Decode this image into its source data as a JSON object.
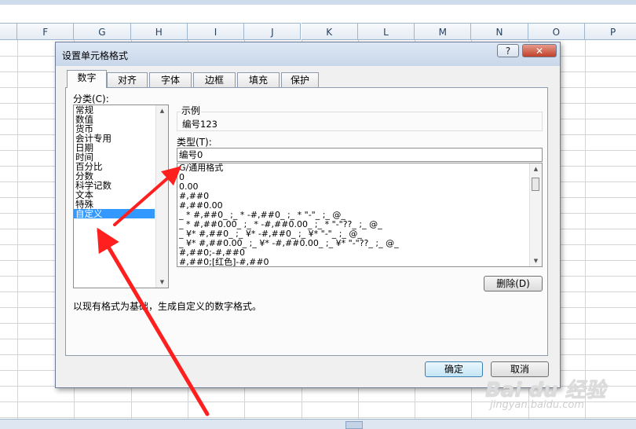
{
  "sheet": {
    "columns": [
      "F",
      "G",
      "H",
      "I",
      "J",
      "K",
      "L",
      "M",
      "N",
      "O",
      "P"
    ]
  },
  "dialog": {
    "title": "设置单元格格式",
    "help_label": "?",
    "close_label": "✕",
    "tabs": [
      "数字",
      "对齐",
      "字体",
      "边框",
      "填充",
      "保护"
    ],
    "category_label": "分类(C):",
    "categories": [
      "常规",
      "数值",
      "货币",
      "会计专用",
      "日期",
      "时间",
      "百分比",
      "分数",
      "科学记数",
      "文本",
      "特殊",
      "自定义"
    ],
    "selected_category": "自定义",
    "sample_label": "示例",
    "sample_value": "编号123",
    "type_label": "类型(T):",
    "type_value": "编号0",
    "formats": [
      "G/通用格式",
      "0",
      "0.00",
      "#,##0",
      "#,##0.00",
      "_ * #,##0_ ;_ * -#,##0_ ;_ * \"-\"_ ;_ @_",
      "_ * #,##0.00_ ;_ * -#,##0.00_ ;_ * \"-\"??_ ;_ @_",
      "_ ¥* #,##0_ ;_ ¥* -#,##0_ ;_ ¥* \"-\"_ ;_ @_",
      "_ ¥* #,##0.00_ ;_ ¥* -#,##0.00_ ;_ ¥* \"-\"??_ ;_ @_",
      "#,##0;-#,##0",
      "#,##0;[红色]-#,##0"
    ],
    "delete_label": "删除(D)",
    "description": "以现有格式为基础，生成自定义的数字格式。",
    "ok_label": "确定",
    "cancel_label": "取消"
  },
  "watermark": {
    "brand": "Bai du 经验",
    "url": "jingyan.baidu.com"
  },
  "colors": {
    "arrow": "#ff1f1f",
    "selection": "#3399ff",
    "grid": "#d4d4d4"
  }
}
